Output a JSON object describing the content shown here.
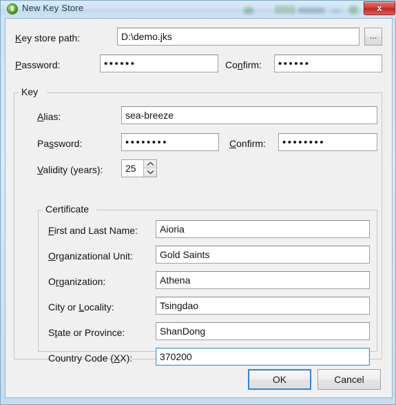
{
  "window": {
    "title": "New Key Store",
    "icon": "keystore-icon",
    "close_label": "x",
    "accent_color": "#2f86d2",
    "close_color": "#d23b33"
  },
  "keystore": {
    "path_label": "Key store path:",
    "path_mnemonic": "K",
    "path_value": "D:\\demo.jks",
    "browse_label": "...",
    "password_label": "Password:",
    "password_mnemonic": "P",
    "password_value": "••••••",
    "confirm_label": "Confirm:",
    "confirm_mnemonic": "n",
    "confirm_value": "••••••"
  },
  "key": {
    "group_title": "Key",
    "alias_label": "Alias:",
    "alias_mnemonic": "A",
    "alias_value": "sea-breeze",
    "password_label": "Password:",
    "password_mnemonic": "s",
    "password_value": "••••••••",
    "confirm_label": "Confirm:",
    "confirm_mnemonic": "C",
    "confirm_value": "••••••••",
    "validity_label": "Validity (years):",
    "validity_mnemonic": "V",
    "validity_value": "25"
  },
  "certificate": {
    "group_title": "Certificate",
    "fields": [
      {
        "label": "First and Last Name:",
        "mnemonic": "F",
        "value": "Aioria",
        "focused": false
      },
      {
        "label": "Organizational Unit:",
        "mnemonic": "O",
        "value": "Gold Saints",
        "focused": false
      },
      {
        "label": "Organization:",
        "mnemonic": "r",
        "value": "Athena",
        "focused": false
      },
      {
        "label": "City or Locality:",
        "mnemonic": "L",
        "value": "Tsingdao",
        "focused": false
      },
      {
        "label": "State or Province:",
        "mnemonic": "t",
        "value": "ShanDong",
        "focused": false
      },
      {
        "label": "Country Code (XX):",
        "mnemonic": "X",
        "value": "370200",
        "focused": true
      }
    ]
  },
  "buttons": {
    "ok_label": "OK",
    "cancel_label": "Cancel"
  }
}
